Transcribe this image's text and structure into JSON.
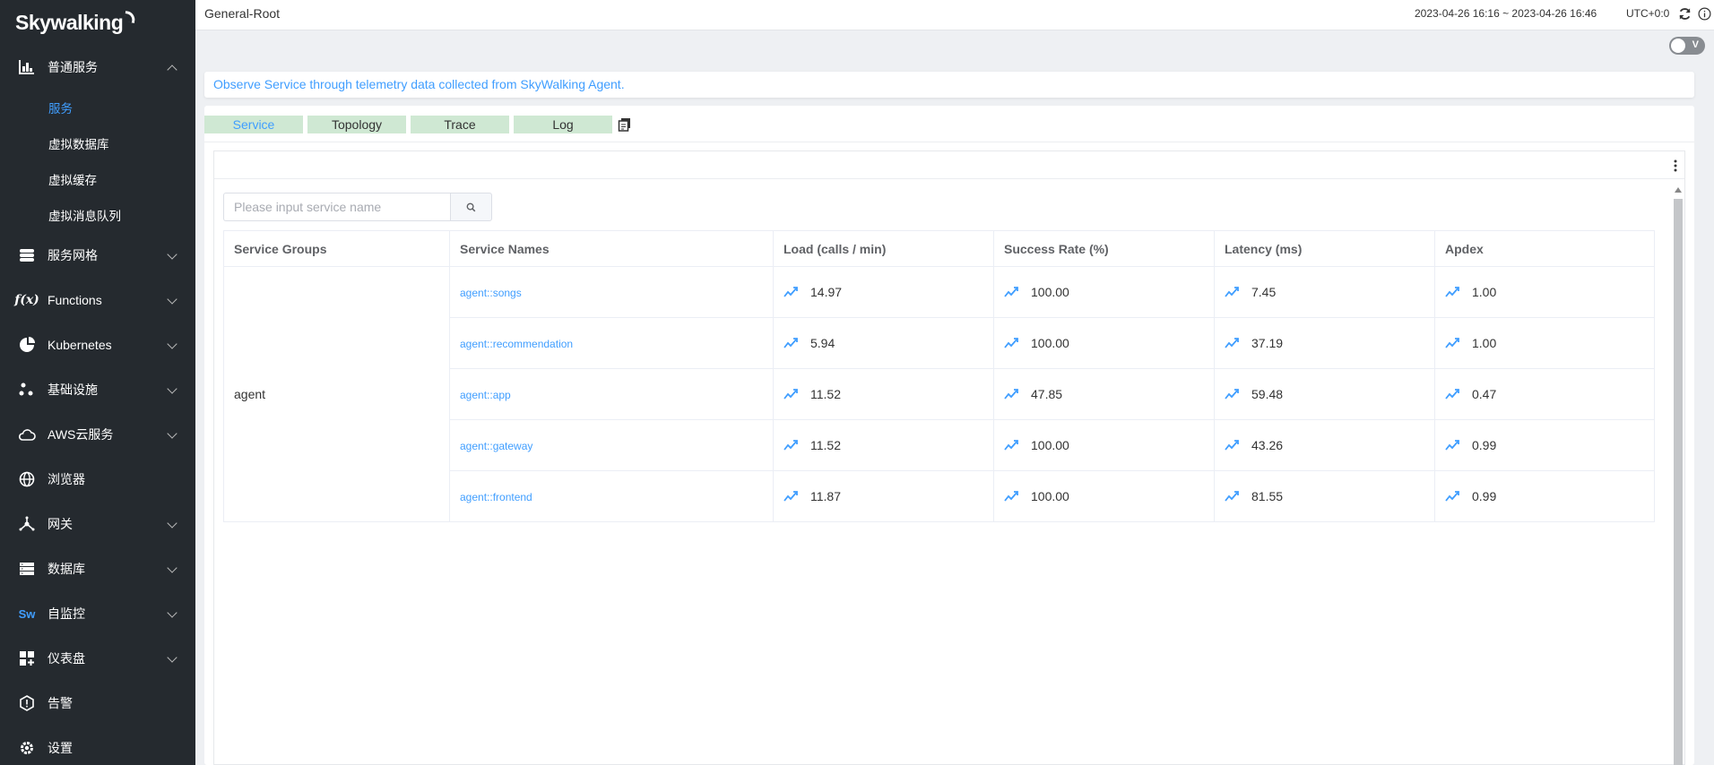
{
  "sidebar": {
    "logo": "Skywalking",
    "items": [
      {
        "label": "普通服务",
        "icon": "bar-chart-icon",
        "expanded": true,
        "children": [
          {
            "label": "服务",
            "active": true
          },
          {
            "label": "虚拟数据库"
          },
          {
            "label": "虚拟缓存"
          },
          {
            "label": "虚拟消息队列"
          }
        ]
      },
      {
        "label": "服务网格",
        "icon": "mesh-icon"
      },
      {
        "label": "Functions",
        "icon": "function-icon"
      },
      {
        "label": "Kubernetes",
        "icon": "pie-icon"
      },
      {
        "label": "基础设施",
        "icon": "nodes-icon"
      },
      {
        "label": "AWS云服务",
        "icon": "cloud-icon"
      },
      {
        "label": "浏览器",
        "icon": "globe-icon"
      },
      {
        "label": "网关",
        "icon": "gateway-icon"
      },
      {
        "label": "数据库",
        "icon": "database-icon"
      },
      {
        "label": "自监控",
        "icon": "sw-icon"
      },
      {
        "label": "仪表盘",
        "icon": "dashboard-icon"
      },
      {
        "label": "告警",
        "icon": "alert-icon"
      },
      {
        "label": "设置",
        "icon": "gear-icon"
      }
    ]
  },
  "header": {
    "breadcrumb": "General-Root",
    "time_range": "2023-04-26 16:16 ~ 2023-04-26 16:46",
    "timezone": "UTC+0:0",
    "toggle_label": "V"
  },
  "description": "Observe Service through telemetry data collected from SkyWalking Agent.",
  "tabs": [
    "Service",
    "Topology",
    "Trace",
    "Log"
  ],
  "search": {
    "placeholder": "Please input service name",
    "value": ""
  },
  "table": {
    "headers": [
      "Service Groups",
      "Service Names",
      "Load (calls / min)",
      "Success Rate (%)",
      "Latency (ms)",
      "Apdex"
    ],
    "group": "agent",
    "rows": [
      {
        "name": "agent::songs",
        "load": "14.97",
        "success": "100.00",
        "latency": "7.45",
        "apdex": "1.00"
      },
      {
        "name": "agent::recommendation",
        "load": "5.94",
        "success": "100.00",
        "latency": "37.19",
        "apdex": "1.00"
      },
      {
        "name": "agent::app",
        "load": "11.52",
        "success": "47.85",
        "latency": "59.48",
        "apdex": "0.47"
      },
      {
        "name": "agent::gateway",
        "load": "11.52",
        "success": "100.00",
        "latency": "43.26",
        "apdex": "0.99"
      },
      {
        "name": "agent::frontend",
        "load": "11.87",
        "success": "100.00",
        "latency": "81.55",
        "apdex": "0.99"
      }
    ]
  },
  "colors": {
    "accent": "#409eff",
    "sidebar_bg": "#252a2f",
    "tab_bg": "#cfe8d3"
  }
}
